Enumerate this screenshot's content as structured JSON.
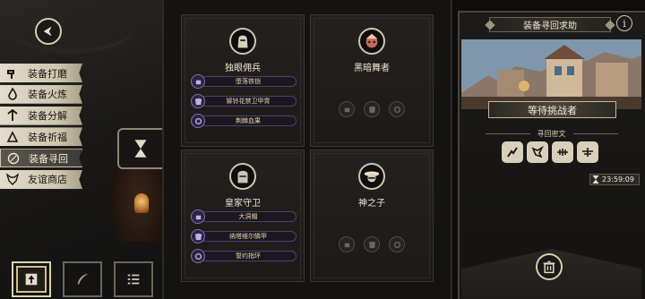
{
  "menu": {
    "items": [
      {
        "label": "装备打磨",
        "icon": "hammer-icon",
        "active": false
      },
      {
        "label": "装备火炼",
        "icon": "flame-icon",
        "active": false
      },
      {
        "label": "装备分解",
        "icon": "split-icon",
        "active": false
      },
      {
        "label": "装备祈福",
        "icon": "pray-icon",
        "active": false
      },
      {
        "label": "装备寻回",
        "icon": "compass-icon",
        "active": true
      },
      {
        "label": "友谊商店",
        "icon": "fox-icon",
        "active": false
      }
    ]
  },
  "bottom_bar": {
    "buttons": [
      {
        "name": "upload",
        "icon": "up-arrow-icon",
        "active": true
      },
      {
        "name": "feather",
        "icon": "feather-icon",
        "active": false
      },
      {
        "name": "list",
        "icon": "list-icon",
        "active": false
      }
    ]
  },
  "cards": [
    {
      "name": "独眼佣兵",
      "avatar": "one-eyed-mercenary",
      "equipment": [
        "堕落铁铠",
        "铆铃花禁卫甲胄",
        "荆棘血果"
      ]
    },
    {
      "name": "黑暗舞者",
      "avatar": "dark-dancer",
      "equipment": []
    },
    {
      "name": "皇家守卫",
      "avatar": "royal-guard",
      "equipment": [
        "大洞帽",
        "纳塔维尔鳞甲",
        "誓约指环"
      ]
    },
    {
      "name": "神之子",
      "avatar": "child-of-god",
      "equipment": []
    }
  ],
  "right_panel": {
    "title": "装备寻回求助",
    "info_label": "i",
    "status": "等待挑战者",
    "clue_label": "寻回密文",
    "timer": "23:59:09"
  },
  "colors": {
    "accent_cream": "#cfc6b0",
    "equip_purple": "#7f6fb0",
    "background": "#0d0c0b"
  }
}
